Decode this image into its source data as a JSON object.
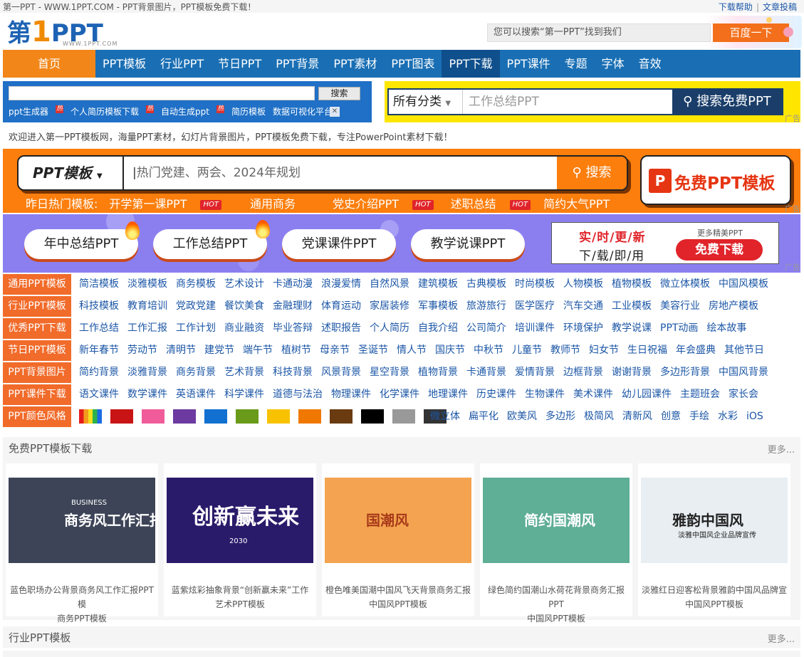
{
  "topbar": {
    "title": "第一PPT - WWW.1PPT.COM - PPT背景图片，PPT模板免费下载！",
    "links": [
      "下载帮助",
      "文章投稿"
    ]
  },
  "logo": {
    "text_a": "第",
    "text_b": "1",
    "text_c": "PPT",
    "sub": "WWW.1PPT.COM"
  },
  "header_search": {
    "placeholder": "您可以搜索“第一PPT”找到我们",
    "button": "百度一下"
  },
  "nav": {
    "home": "首页",
    "items": [
      "PPT模板",
      "行业PPT",
      "节日PPT",
      "PPT背景",
      "PPT素材",
      "PPT图表",
      "PPT下载",
      "PPT课件",
      "专题",
      "字体",
      "音效"
    ],
    "active_index": 6
  },
  "search_left": {
    "button": "搜索",
    "links": [
      "ppt生成器",
      "个人简历模板下载",
      "自动生成ppt",
      "简历模板",
      "数据可视化平台"
    ],
    "hot_badge": "热",
    "close": "✕"
  },
  "search_right": {
    "category": "所有分类",
    "placeholder": "工作总结PPT",
    "button": "搜索免费PPT"
  },
  "ad_label": "广告",
  "welcome": "欢迎进入第一PPT模板网，海量PPT素材，幻灯片背景图片，PPT模板免费下载，专注PowerPoint素材下载！",
  "orange_banner": {
    "category": "PPT模板",
    "placeholder": "热门党建、两会、2024年规划",
    "button": "搜索",
    "free_label": "免费PPT模板",
    "hot_label": "昨日热门模板:",
    "hot_items": [
      {
        "label": "开学第一课PPT",
        "hot": true
      },
      {
        "label": "通用商务",
        "hot": false
      },
      {
        "label": "党史介绍PPT",
        "hot": true
      },
      {
        "label": "述职总结",
        "hot": true
      },
      {
        "label": "简约大气PPT",
        "hot": false
      }
    ],
    "hot_badge": "HOT"
  },
  "purple_banner": {
    "pills": [
      "年中总结PPT",
      "工作总结PPT",
      "党课课件PPT",
      "教学说课PPT"
    ],
    "ad_line1": "实/时/更/新",
    "ad_line2": "下/载/即/用",
    "ad_more": "更多精美PPT",
    "ad_button": "免费下载"
  },
  "categories": [
    {
      "label": "通用PPT模板",
      "links": [
        "简洁模板",
        "淡雅模板",
        "商务模板",
        "艺术设计",
        "卡通动漫",
        "浪漫爱情",
        "自然风景",
        "建筑模板",
        "古典模板",
        "时尚模板",
        "人物模板",
        "植物模板",
        "微立体模板",
        "中国风模板"
      ]
    },
    {
      "label": "行业PPT模板",
      "links": [
        "科技模板",
        "教育培训",
        "党政党建",
        "餐饮美食",
        "金融理财",
        "体育运动",
        "家居装修",
        "军事模板",
        "旅游旅行",
        "医学医疗",
        "汽车交通",
        "工业模板",
        "美容行业",
        "房地产模板"
      ]
    },
    {
      "label": "优秀PPT下载",
      "links": [
        "工作总结",
        "工作汇报",
        "工作计划",
        "商业融资",
        "毕业答辩",
        "述职报告",
        "个人简历",
        "自我介绍",
        "公司简介",
        "培训课件",
        "环境保护",
        "教学说课",
        "PPT动画",
        "绘本故事"
      ]
    },
    {
      "label": "节日PPT模板",
      "links": [
        "新年春节",
        "劳动节",
        "清明节",
        "建党节",
        "端午节",
        "植树节",
        "母亲节",
        "圣诞节",
        "情人节",
        "国庆节",
        "中秋节",
        "儿童节",
        "教师节",
        "妇女节",
        "生日祝福",
        "年会盛典",
        "其他节日"
      ]
    },
    {
      "label": "PPT背景图片",
      "links": [
        "简约背景",
        "淡雅背景",
        "商务背景",
        "艺术背景",
        "科技背景",
        "风景背景",
        "星空背景",
        "植物背景",
        "卡通背景",
        "爱情背景",
        "边框背景",
        "谢谢背景",
        "多边形背景",
        "中国风背景"
      ]
    },
    {
      "label": "PPT课件下载",
      "links": [
        "语文课件",
        "数学课件",
        "英语课件",
        "科学课件",
        "道德与法治",
        "物理课件",
        "化学课件",
        "地理课件",
        "历史课件",
        "生物课件",
        "美术课件",
        "幼儿园课件",
        "主题班会",
        "家长会"
      ]
    }
  ],
  "color_row": {
    "label": "PPT颜色风格",
    "swatches": [
      "rainbow",
      "#c81414",
      "#f05c9a",
      "#6c3aa0",
      "#1170d0",
      "#6a9a1a",
      "#f8c200",
      "#f07800",
      "#6a3a10",
      "#000000",
      "#999999",
      "#333333"
    ],
    "styles": [
      "微立体",
      "扁平化",
      "欧美风",
      "多边形",
      "极简风",
      "清新风",
      "创意",
      "手绘",
      "水彩",
      "iOS"
    ]
  },
  "section_free": {
    "title": "免费PPT模板下载",
    "more": "更多...",
    "cards": [
      {
        "img_title": "商务风工作汇报",
        "img_sub": "BUSINESS",
        "caption1": "蓝色职场办公背景商务风工作汇报PPT模",
        "caption2": "商务PPT模板",
        "bg": "#3d4457",
        "fg": "#ffffff"
      },
      {
        "img_title": "创新赢未来",
        "img_sub": "2030",
        "caption1": "蓝紫炫彩抽象背景“创新赢未来”工作",
        "caption2": "艺术PPT模板",
        "bg": "#2a1a6a",
        "fg": "#ffffff"
      },
      {
        "img_title": "国潮风",
        "img_sub": "",
        "caption1": "橙色唯美国潮中国风飞天背景商务汇报",
        "caption2": "中国风PPT模板",
        "bg": "#f4a450",
        "fg": "#a83a1a"
      },
      {
        "img_title": "简约国潮风",
        "img_sub": "",
        "caption1": "绿色简约国潮山水荷花背景商务汇报PPT",
        "caption2": "中国风PPT模板",
        "bg": "#5fae96",
        "fg": "#ffffff"
      },
      {
        "img_title": "雅韵中国风",
        "img_sub": "淡雅中国风企业品牌宣传",
        "caption1": "淡雅红日迎客松背景雅韵中国风品牌宣",
        "caption2": "中国风PPT模板",
        "bg": "#e8eef2",
        "fg": "#222222"
      }
    ]
  },
  "section_industry": {
    "title": "行业PPT模板",
    "more": "更多..."
  },
  "colors": {
    "nav_blue": "#1a6fb4",
    "nav_active": "#0f4f8c",
    "orange": "#f28618",
    "link_blue": "#1b56a6",
    "label_orange": "#f16b2a"
  }
}
